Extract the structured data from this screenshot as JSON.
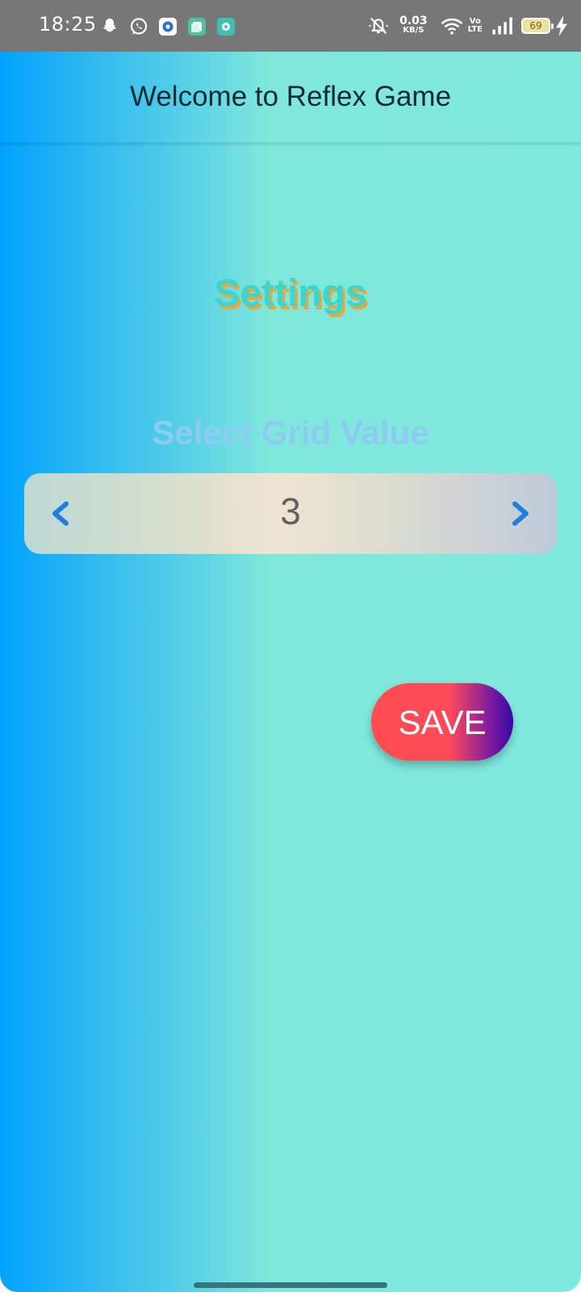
{
  "status_bar": {
    "time": "18:25",
    "net_speed_value": "0.03",
    "net_speed_unit": "KB/S",
    "volte_line1": "Vo",
    "volte_line2": "LTE",
    "battery_level": "69",
    "notification_icons": [
      "snapchat-icon",
      "whatsapp-icon",
      "app-notification-icon",
      "app-notification-icon",
      "app-notification-icon"
    ]
  },
  "app_bar": {
    "title": "Welcome to Reflex Game"
  },
  "main": {
    "heading": "Settings",
    "grid_label": "Select Grid Value",
    "grid_value": "3",
    "save_label": "SAVE"
  },
  "colors": {
    "gradient_left": "#00a2ff",
    "gradient_right": "#80e9dd",
    "heading_color": "#3fd5cf",
    "heading_shadow": "#e8a83b",
    "arrow_color": "#1e7fe0",
    "save_start": "#ff4d4f",
    "save_end": "#3608a7"
  }
}
